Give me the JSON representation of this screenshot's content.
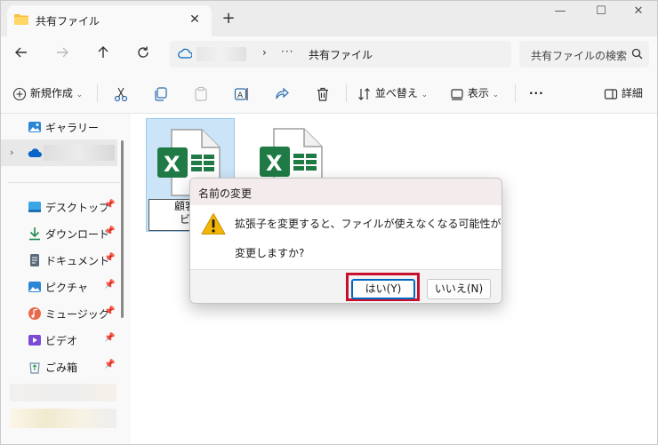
{
  "window": {
    "tab_title": "共有ファイル",
    "tab_close": "✕",
    "new_tab": "+",
    "minimize": "—",
    "maximize": "☐",
    "close": "✕"
  },
  "address": {
    "chevron": "›",
    "more": "···",
    "current_folder": "共有ファイル",
    "search_placeholder": "共有ファイルの検索"
  },
  "toolbar": {
    "new_label": "新規作成",
    "sort_label": "並べ替え",
    "view_label": "表示",
    "more_label": "···",
    "details_label": "詳細"
  },
  "sidebar": {
    "gallery": "ギャラリー",
    "items": [
      {
        "label": "デスクトップ",
        "icon": "desktop-icon"
      },
      {
        "label": "ダウンロード",
        "icon": "download-icon"
      },
      {
        "label": "ドキュメント",
        "icon": "document-icon"
      },
      {
        "label": "ピクチャ",
        "icon": "pictures-icon"
      },
      {
        "label": "ミュージック",
        "icon": "music-icon"
      },
      {
        "label": "ビデオ",
        "icon": "video-icon"
      },
      {
        "label": "ごみ箱",
        "icon": "recycle-bin-icon"
      }
    ],
    "pin": "📌"
  },
  "files": [
    {
      "name_line1": "顧客情",
      "name_line2": "ビー",
      "icon": "excel-file-icon",
      "selected": true
    },
    {
      "icon": "excel-file-icon",
      "selected": false
    }
  ],
  "dialog": {
    "title": "名前の変更",
    "message": "拡張子を変更すると、ファイルが使えなくなる可能性があります。",
    "question": "変更しますか?",
    "yes": "はい(Y)",
    "no": "いいえ(N)"
  },
  "colors": {
    "accent": "#0067c0",
    "highlight": "#c8102e",
    "excel_green": "#1f7a45",
    "warning": "#f2b705"
  }
}
